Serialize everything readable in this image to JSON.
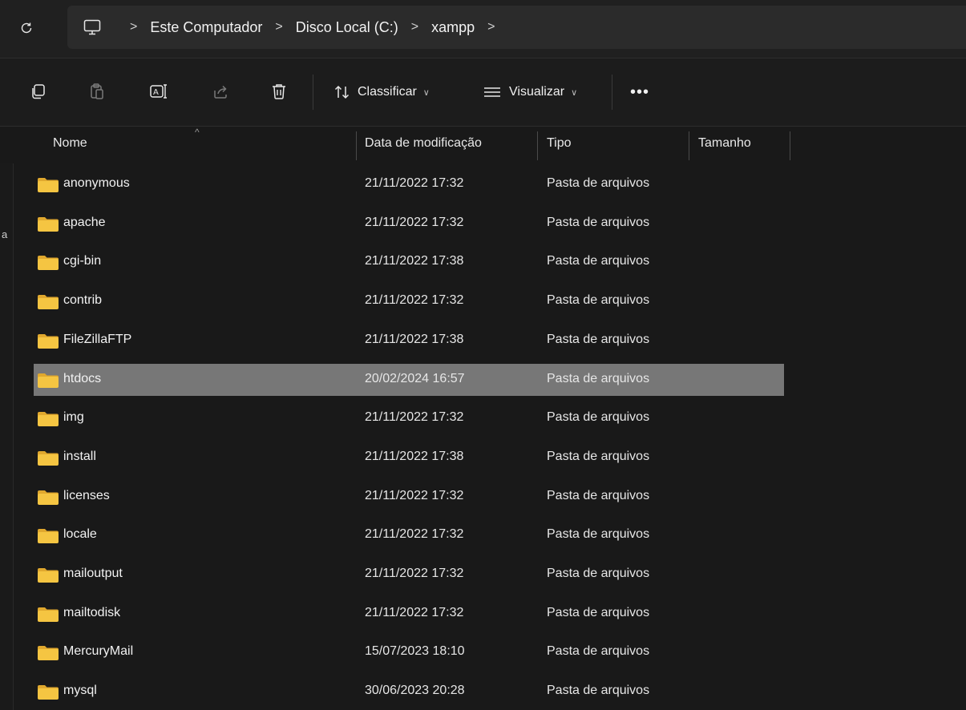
{
  "address": {
    "crumbs": [
      "Este Computador",
      "Disco Local (C:)",
      "xampp"
    ],
    "separator": ">"
  },
  "toolbar": {
    "icons": [
      "copy-icon",
      "paste-icon",
      "rename-icon",
      "share-icon",
      "delete-icon"
    ],
    "sort_label": "Classificar",
    "view_label": "Visualizar",
    "more_label": "•••"
  },
  "header": {
    "name": "Nome",
    "date": "Data de modificação",
    "type": "Tipo",
    "size": "Tamanho",
    "sort_indicator": "^"
  },
  "left_edge_char": "a",
  "colors": {
    "background": "#191919",
    "selected_row": "#777777",
    "folder": "#f5c542"
  },
  "files": [
    {
      "name": "anonymous",
      "date": "21/11/2022 17:32",
      "type": "Pasta de arquivos",
      "selected": false
    },
    {
      "name": "apache",
      "date": "21/11/2022 17:32",
      "type": "Pasta de arquivos",
      "selected": false
    },
    {
      "name": "cgi-bin",
      "date": "21/11/2022 17:38",
      "type": "Pasta de arquivos",
      "selected": false
    },
    {
      "name": "contrib",
      "date": "21/11/2022 17:32",
      "type": "Pasta de arquivos",
      "selected": false
    },
    {
      "name": "FileZillaFTP",
      "date": "21/11/2022 17:38",
      "type": "Pasta de arquivos",
      "selected": false
    },
    {
      "name": "htdocs",
      "date": "20/02/2024 16:57",
      "type": "Pasta de arquivos",
      "selected": true
    },
    {
      "name": "img",
      "date": "21/11/2022 17:32",
      "type": "Pasta de arquivos",
      "selected": false
    },
    {
      "name": "install",
      "date": "21/11/2022 17:38",
      "type": "Pasta de arquivos",
      "selected": false
    },
    {
      "name": "licenses",
      "date": "21/11/2022 17:32",
      "type": "Pasta de arquivos",
      "selected": false
    },
    {
      "name": "locale",
      "date": "21/11/2022 17:32",
      "type": "Pasta de arquivos",
      "selected": false
    },
    {
      "name": "mailoutput",
      "date": "21/11/2022 17:32",
      "type": "Pasta de arquivos",
      "selected": false
    },
    {
      "name": "mailtodisk",
      "date": "21/11/2022 17:32",
      "type": "Pasta de arquivos",
      "selected": false
    },
    {
      "name": "MercuryMail",
      "date": "15/07/2023 18:10",
      "type": "Pasta de arquivos",
      "selected": false
    },
    {
      "name": "mysql",
      "date": "30/06/2023 20:28",
      "type": "Pasta de arquivos",
      "selected": false
    }
  ]
}
